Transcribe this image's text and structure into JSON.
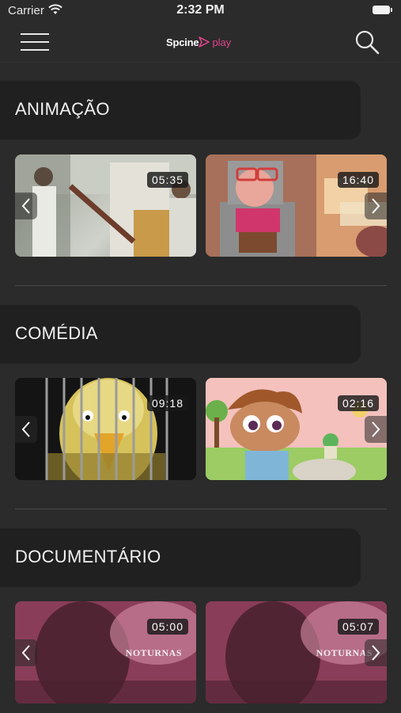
{
  "status_bar": {
    "carrier": "Carrier",
    "time": "2:32 PM"
  },
  "header": {
    "logo_brand": "Spcine",
    "logo_play": "play",
    "menu_icon": "hamburger-menu-icon",
    "search_icon": "search-icon",
    "accent_color": "#e0448a"
  },
  "sections": [
    {
      "title": "ANIMAÇÃO",
      "items": [
        {
          "duration": "05:35"
        },
        {
          "duration": "16:40"
        }
      ]
    },
    {
      "title": "COMÉDIA",
      "items": [
        {
          "duration": "09:18"
        },
        {
          "duration": "02:16"
        }
      ]
    },
    {
      "title": "DOCUMENTÁRIO",
      "items": [
        {
          "duration": "05:00",
          "overlay_text": "NOTURNAS"
        },
        {
          "duration": "05:07",
          "overlay_text": "NOTURNAS"
        }
      ]
    }
  ]
}
